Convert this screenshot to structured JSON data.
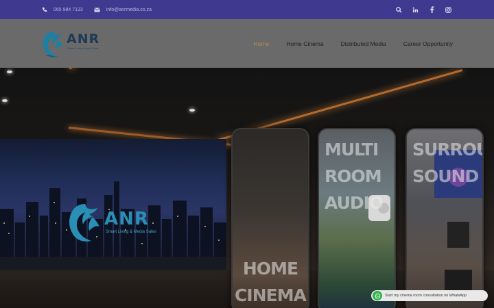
{
  "topbar": {
    "phone": "065 984 7133",
    "email": "info@anrmedia.co.za",
    "icons": [
      "search-icon",
      "linkedin-icon",
      "facebook-icon",
      "instagram-icon"
    ]
  },
  "header": {
    "logo": {
      "text": "ANR",
      "tagline": "Smart Living Media Sales"
    },
    "nav": [
      {
        "label": "Home",
        "active": true
      },
      {
        "label": "Home Cinema",
        "active": false
      },
      {
        "label": "Distributed Media",
        "active": false
      },
      {
        "label": "Career Opportunity",
        "active": false
      }
    ]
  },
  "hero": {
    "screen_logo": {
      "text": "ANR",
      "tagline": "Smart Living & Media Sales"
    },
    "cards": [
      {
        "line1": "HOME",
        "line2": "CINEMA"
      },
      {
        "line1": "MULTI",
        "line2": "ROOM",
        "line3": "AUDIO"
      },
      {
        "line1": "SURROUND",
        "line2": "SOUND"
      }
    ]
  },
  "whatsapp": {
    "label": "Start my cinema room consultation on WhatsApp"
  },
  "colors": {
    "topbar": "#3f3a8f",
    "nav_active": "#b58a55",
    "whatsapp": "#2fb34a"
  }
}
